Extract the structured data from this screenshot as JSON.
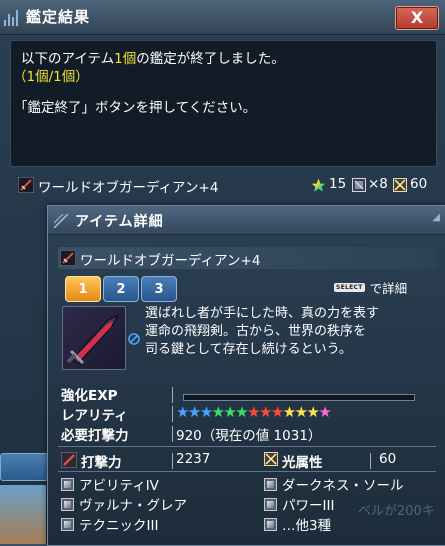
{
  "window": {
    "title": "鑑定結果",
    "close_label": "X"
  },
  "message": {
    "line1_prefix": "以下のアイテム",
    "line1_count": "1個",
    "line1_suffix": "の鑑定が終了しました。",
    "progress": "（1個/1個）",
    "instruction": "「鑑定終了」ボタンを押してください。"
  },
  "result": {
    "item_name": "ワールドオブガーディアン+4",
    "rarity": "15",
    "slots": "×8",
    "element": "60"
  },
  "detail": {
    "title": "アイテム詳細",
    "item_name": "ワールドオブガーディアン+4",
    "tabs": [
      "1",
      "2",
      "3"
    ],
    "active_tab": "1",
    "select_key": "SELECT",
    "select_label": "で詳細",
    "description": [
      "選ばれし者が手にした時、真の力を表す",
      "運命の飛翔剣。古から、世界の秩序を",
      "司る鍵として存在し続けるという。"
    ],
    "enhance_exp_label": "強化EXP",
    "enhance_exp_progress": 0,
    "rarity_label": "レアリティ",
    "rarity_stars": 13,
    "star_colors": [
      "#4aa3ff",
      "#4aa3ff",
      "#4aa3ff",
      "#3ddc6a",
      "#3ddc6a",
      "#3ddc6a",
      "#ff4a3a",
      "#ff4a3a",
      "#ff4a3a",
      "#ffe14a",
      "#ffe14a",
      "#ffe14a",
      "#ff6ad5"
    ],
    "required_label": "必要打撃力",
    "required_value": "920（現在の値 1031）",
    "attack_label": "打撃力",
    "attack_value": "2237",
    "attr_label": "光属性",
    "attr_value": "60",
    "abilities": [
      "アビリティIV",
      "ダークネス・ソール",
      "ヴァルナ・グレア",
      "パワーIII",
      "テクニックIII",
      "…他3種"
    ]
  },
  "background": {
    "right_text": "ベルが200キ"
  },
  "colors": {
    "highlight_yellow": "#f2e23a",
    "tab_active": "#f0a020",
    "tab_inactive": "#3a6ea8",
    "close_button": "#c44a3c"
  }
}
